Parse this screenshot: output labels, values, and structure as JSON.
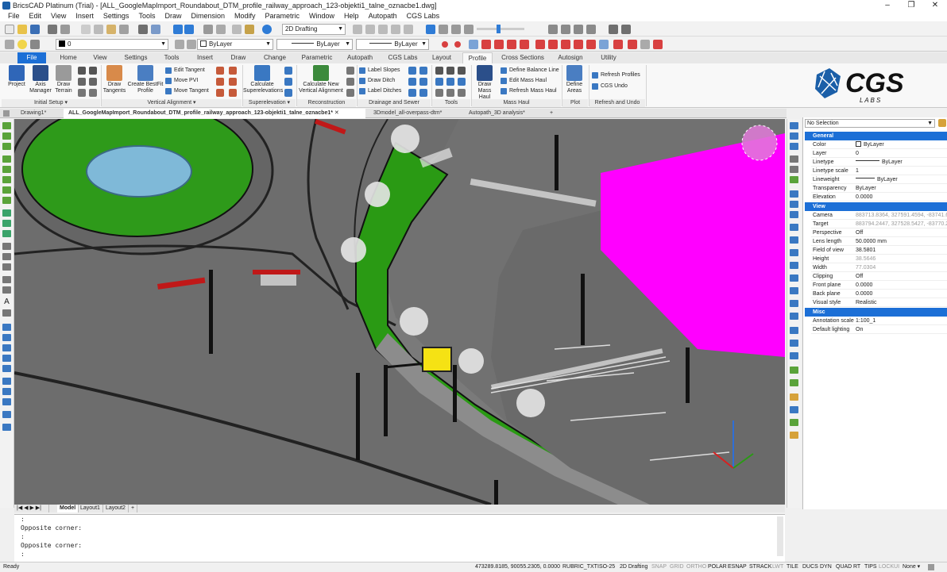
{
  "window": {
    "title": "BricsCAD Platinum (Trial) - [ALL_GoogleMapImport_Roundabout_DTM_profile_railway_approach_123-objekti1_talne_oznacbe1.dwg]",
    "controls": [
      "–",
      "❐",
      "✕"
    ]
  },
  "menu": [
    "File",
    "Edit",
    "View",
    "Insert",
    "Settings",
    "Tools",
    "Draw",
    "Dimension",
    "Modify",
    "Parametric",
    "Window",
    "Help",
    "Autopath",
    "CGS Labs"
  ],
  "toolbar": {
    "workspace": "2D Drafting",
    "layer_value": "0",
    "color_value": "ByLayer",
    "linetype_value": "ByLayer",
    "lineweight_value": "ByLayer"
  },
  "ribbon": {
    "tabs": [
      "File",
      "Home",
      "View",
      "Settings",
      "Tools",
      "Insert",
      "Draw",
      "Change",
      "Parametric",
      "Autopath",
      "CGS Labs",
      "Layout",
      "Profile",
      "Cross Sections",
      "Autosign",
      "Utility"
    ],
    "active_tab": "Profile",
    "buttons": {
      "project": "Project",
      "axis_manager": "Axis Manager",
      "draw_terrain": "Draw Terrain",
      "draw_tangents": "Draw Tangents",
      "create_bestfit": "Create BestFit Profile",
      "edit_tangent": "Edit Tangent",
      "move_pvi": "Move PVI",
      "move_tangent": "Move Tangent",
      "calc_superelevations": "Calculate Superelevations",
      "calc_new_vertical": "Calculate New Vertical Alignment",
      "label_slopes": "Label Slopes",
      "draw_ditch": "Draw Ditch",
      "label_ditches": "Label Ditches",
      "draw_mass_haul": "Draw Mass Haul",
      "define_balance_line": "Define Balance Line",
      "edit_mass_haul": "Edit Mass Haul",
      "refresh_mass_haul": "Refresh Mass Haul",
      "define_areas": "Define Areas",
      "refresh_profiles": "Refresh Profiles",
      "cgs_undo": "CGS Undo"
    },
    "groups": [
      "Initial Setup",
      "Vertical Alignment",
      "Superelevation",
      "Reconstruction",
      "Drainage and Sewer",
      "Tools",
      "Mass Haul",
      "Plot",
      "Refresh and Undo"
    ],
    "logo": {
      "main": "CGS",
      "sub": "L A B S"
    }
  },
  "doc_tabs": [
    "Drawing1*",
    "ALL_GoogleMapImport_Roundabout_DTM_profile_railway_approach_123-objekti1_talne_oznacbe1*",
    "3Dmodel_all-overpass-dtm*",
    "Autopath_3D analysis*"
  ],
  "properties": {
    "selection": "No Selection",
    "general_label": "General",
    "general": [
      {
        "k": "Color",
        "v": "ByLayer"
      },
      {
        "k": "Layer",
        "v": "0"
      },
      {
        "k": "Linetype",
        "v": "ByLayer"
      },
      {
        "k": "Linetype scale",
        "v": "1"
      },
      {
        "k": "Lineweight",
        "v": "ByLayer"
      },
      {
        "k": "Transparency",
        "v": "ByLayer"
      },
      {
        "k": "Elevation",
        "v": "0.0000"
      }
    ],
    "view_label": "View",
    "view": [
      {
        "k": "Camera",
        "v": "883713.8364, 327591.4594, -83741.6"
      },
      {
        "k": "Target",
        "v": "883794.2447, 327528.5427, -83770.2"
      },
      {
        "k": "Perspective",
        "v": "Off"
      },
      {
        "k": "Lens length",
        "v": "50.0000 mm"
      },
      {
        "k": "Field of view",
        "v": "38.5801"
      },
      {
        "k": "Height",
        "v": "38.5646"
      },
      {
        "k": "Width",
        "v": "77.0304"
      },
      {
        "k": "Clipping",
        "v": "Off"
      },
      {
        "k": "Front plane",
        "v": "0.0000"
      },
      {
        "k": "Back plane",
        "v": "0.0000"
      },
      {
        "k": "Visual style",
        "v": "Realistic"
      }
    ],
    "misc_label": "Misc",
    "misc": [
      {
        "k": "Annotation scale",
        "v": "1:100_1"
      },
      {
        "k": "Default lighting",
        "v": "On"
      }
    ]
  },
  "layout_tabs": [
    "Model",
    "Layout1",
    "Layout2",
    "+"
  ],
  "command_lines": [
    ":",
    "Opposite corner:",
    ":",
    "Opposite corner:",
    ":"
  ],
  "status": {
    "ready": "Ready",
    "coords": "473289.8185, 90055.2305, 0.0000",
    "items": [
      "RUBRIC_TXT",
      "ISO-25",
      "2D Drafting",
      "SNAP",
      "GRID",
      "ORTHO",
      "POLAR",
      "ESNAP",
      "STRACK",
      "LWT",
      "TILE",
      "DUCS",
      "DYN",
      "QUAD",
      "RT",
      "TIPS",
      "LOCKUI",
      "None"
    ]
  },
  "colors": {
    "accent": "#1c6fd6",
    "grass": "#2e9a1a",
    "magenta": "#ff00ff",
    "road": "#6f6f6f"
  }
}
